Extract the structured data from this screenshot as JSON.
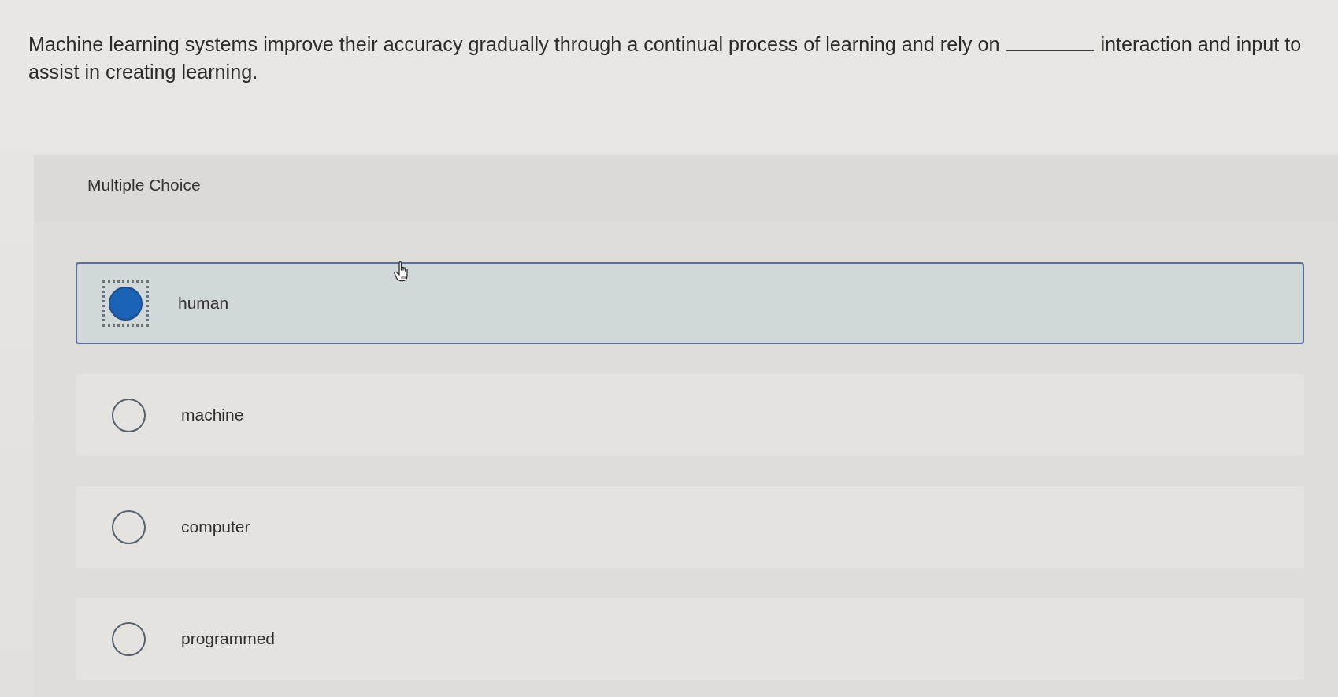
{
  "question": {
    "before": "Machine learning systems improve their accuracy gradually through a continual process of learning and rely on",
    "after": "interaction and input to assist in creating learning."
  },
  "format_label": "Multiple Choice",
  "options": [
    {
      "label": "human",
      "selected": true,
      "focused": true
    },
    {
      "label": "machine",
      "selected": false,
      "focused": false
    },
    {
      "label": "computer",
      "selected": false,
      "focused": false
    },
    {
      "label": "programmed",
      "selected": false,
      "focused": false
    }
  ]
}
